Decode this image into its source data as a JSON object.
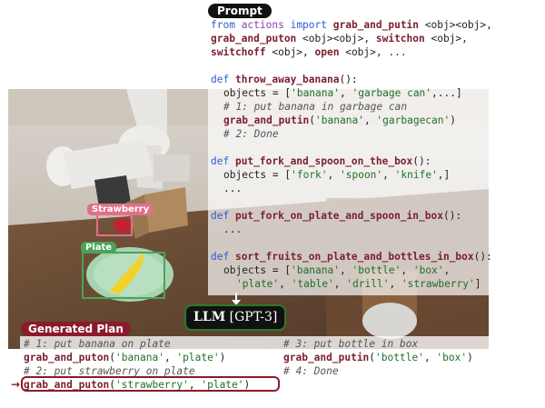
{
  "prompt_badge": "Prompt",
  "code": {
    "l1": [
      "from ",
      "actions",
      " import ",
      "grab_and_putin",
      " <obj><obj>,"
    ],
    "l2": [
      "grab_and_puton",
      " <obj><obj>, ",
      "switchon",
      " <obj>,"
    ],
    "l3": [
      "switchoff",
      " <obj>, ",
      "open",
      " <obj>, ..."
    ],
    "f1_def": "def ",
    "f1_name": "throw_away_banana",
    "f1_tail": "():",
    "f1_obj_head": "objects = [",
    "f1_obj_s1": "'banana'",
    "f1_obj_sep1": ", ",
    "f1_obj_s2": "'garbage can'",
    "f1_obj_tail": ",...]",
    "f1_c1": "# 1: put banana in garbage can",
    "f1_call_fn": "grab_and_putin",
    "f1_call_open": "(",
    "f1_call_a1": "'banana'",
    "f1_call_sep": ", ",
    "f1_call_a2": "'garbagecan'",
    "f1_call_close": ")",
    "f1_c2": "# 2: Done",
    "f2_name": "put_fork_and_spoon_on_the_box",
    "f2_obj_head": "objects = [",
    "f2_s1": "'fork'",
    "f2_s2": "'spoon'",
    "f2_s3": "'knife'",
    "f2_obj_tail": ",]",
    "f2_dots": "...",
    "f3_name": "put_fork_on_plate_and_spoon_in_box",
    "f3_dots": "...",
    "f4_name": "sort_fruits_on_plate_and_bottles_in_box",
    "f4_s1": "'banana'",
    "f4_s2": "'bottle'",
    "f4_s3": "'box'",
    "f4_s4": "'plate'",
    "f4_s5": "'table'",
    "f4_s6": "'drill'",
    "f4_s7": "'strawberry'",
    "f4_close": "]",
    "comma": ",",
    "comma_sp": ", "
  },
  "llm": {
    "bold": "LLM",
    "model": " [GPT-3]"
  },
  "plan_badge": "Generated Plan",
  "plan": {
    "c1": "# 1: put banana on plate",
    "s1_fn": "grab_and_puton",
    "s1_a1": "'banana'",
    "s1_a2": "'plate'",
    "c2": "# 2: put strawberry on plate",
    "s2_fn": "grab_and_puton",
    "s2_a1": "'strawberry'",
    "s2_a2": "'plate'",
    "c3": "# 3: put bottle in box",
    "s3_fn": "grab_and_putin",
    "s3_a1": "'bottle'",
    "s3_a2": "'box'",
    "c4": "# 4: Done",
    "open": "(",
    "sep": ", ",
    "close": ")"
  },
  "detections": {
    "strawberry": "Strawberry",
    "plate": "Plate"
  },
  "colors": {
    "strawberry_label": "#e0708a",
    "plate_label": "#4aa35a",
    "plan_accent": "#8b1a2b",
    "llm_border": "#2a7a2a"
  }
}
